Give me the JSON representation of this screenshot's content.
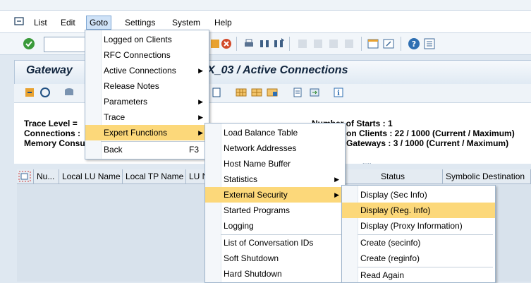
{
  "menubar": {
    "items": [
      "List",
      "Edit",
      "Goto",
      "Settings",
      "System",
      "Help"
    ]
  },
  "title": "Gateway ... X_03 / Active Connections",
  "title_left": "Gateway",
  "title_right": "X_03 / Active Connections",
  "info": {
    "trace_level": "Trace Level =",
    "connections": "Connections :",
    "memory": "Memory Consu",
    "starts": "Number of Starts : 1",
    "clients": "on Clients : 22 / 1000 (Current / Maximum)",
    "gateways": "Gateways : 3 / 1000 (Current / Maximum)",
    "dots": "....."
  },
  "grid": {
    "columns": [
      "Nu...",
      "Local LU Name",
      "Local TP Name",
      "LU N",
      "Status",
      "Symbolic Destination"
    ]
  },
  "goto_menu": {
    "items": [
      "Logged on Clients",
      "RFC Connections",
      "Active Connections",
      "Release Notes",
      "Parameters",
      "Trace",
      "Expert Functions",
      "Back"
    ],
    "back_shortcut": "F3"
  },
  "expert_menu": {
    "items": [
      "Load Balance Table",
      "Network Addresses",
      "Host Name Buffer",
      "Statistics",
      "External Security",
      "Started Programs",
      "Logging",
      "List of Conversation IDs",
      "Soft Shutdown",
      "Hard Shutdown"
    ]
  },
  "security_menu": {
    "items": [
      "Display (Sec Info)",
      "Display (Reg. Info)",
      "Display (Proxy Information)",
      "Create (secinfo)",
      "Create (reginfo)",
      "Read Again"
    ]
  },
  "colors": {
    "highlight": "#fcd87a",
    "menu_border": "#9eb4cb",
    "title_text": "#10243d"
  }
}
